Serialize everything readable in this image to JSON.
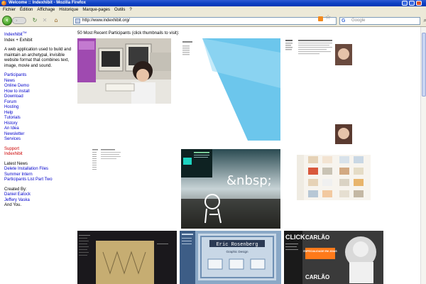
{
  "window": {
    "title": "Welcome :: Indexhibit - Mozilla Firefox"
  },
  "menu": [
    "Fichier",
    "Édition",
    "Affichage",
    "Historique",
    "Marque-pages",
    "Outils",
    "?"
  ],
  "nav": {
    "url": "http://www.indexhibit.org/",
    "search_placeholder": "Google",
    "search_engine_glyph": "G"
  },
  "sidebar": {
    "brand": "Indexhibit",
    "brand_sup": "TM",
    "tagline": "Index + Exhibit",
    "description": "A web application used to build and maintain an archetypal, invisible website format that combines text, image, movie and sound.",
    "links": [
      "Participants",
      "News",
      "Online Demo",
      "How to install",
      "Download",
      "Forum",
      "Hosting",
      "Help",
      "Tutorials",
      "History",
      "An Idea",
      "Newsletter",
      "Services"
    ],
    "support_links": [
      "Support",
      "Indexhibit"
    ],
    "latest_news_label": "Latest News",
    "news_links": [
      "Delete Installation Files",
      "Summer Intern",
      "Participants List Part Two"
    ],
    "created_by_label": "Created By:",
    "creators": [
      "Daniel Eatock",
      "Jeffery Vaska"
    ],
    "and_you": "And You."
  },
  "main": {
    "heading": "50 Most Recent Participants (click thumbnails to visit):",
    "thumb_texts": {
      "graffiti": "&nbsp;",
      "ericlabel": "Eric Rosenberg",
      "ericsub": "Graphic Design",
      "carlao1": "CARLÃO",
      "carlao_special": "ESPECIALIDADE EM JOIAS",
      "carlao2": "CARLÃO",
      "clicke": "CLICK"
    }
  },
  "colors": {
    "link": "#0000cc",
    "support": "#cc0000",
    "titlebar": "#0a3ec0"
  }
}
